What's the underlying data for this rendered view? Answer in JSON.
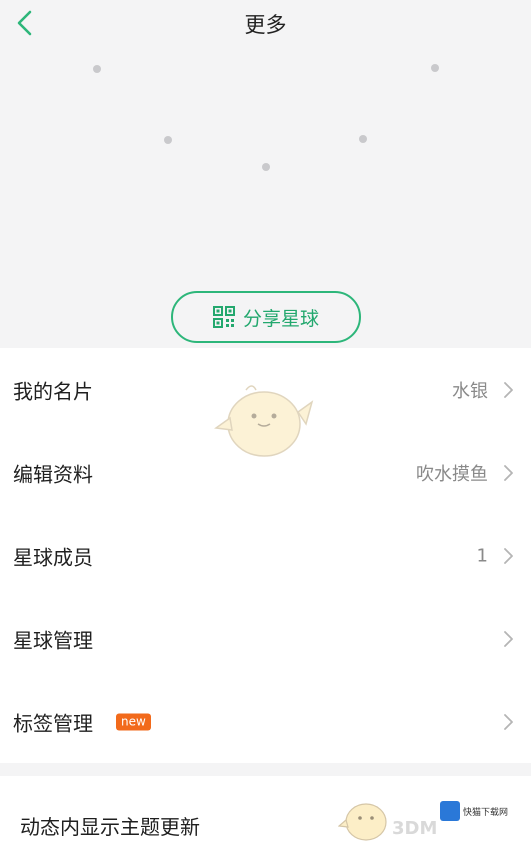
{
  "header": {
    "title": "更多",
    "back_icon": "chevron-left-icon"
  },
  "hero": {
    "share_button_label": "分享星球",
    "share_icon": "qrcode-icon"
  },
  "list": {
    "items": [
      {
        "label": "我的名片",
        "value": "水银"
      },
      {
        "label": "编辑资料",
        "value": "吹水摸鱼"
      },
      {
        "label": "星球成员",
        "value": "1"
      },
      {
        "label": "星球管理",
        "value": ""
      },
      {
        "label": "标签管理",
        "value": "",
        "badge": "new"
      }
    ]
  },
  "bottom": {
    "label": "动态内显示主题更新"
  },
  "watermark": {
    "text": "3DM",
    "site_name": "快猫下载网"
  },
  "colors": {
    "accent": "#2db67a",
    "badge": "#f26a1b",
    "background": "#f4f4f5"
  }
}
